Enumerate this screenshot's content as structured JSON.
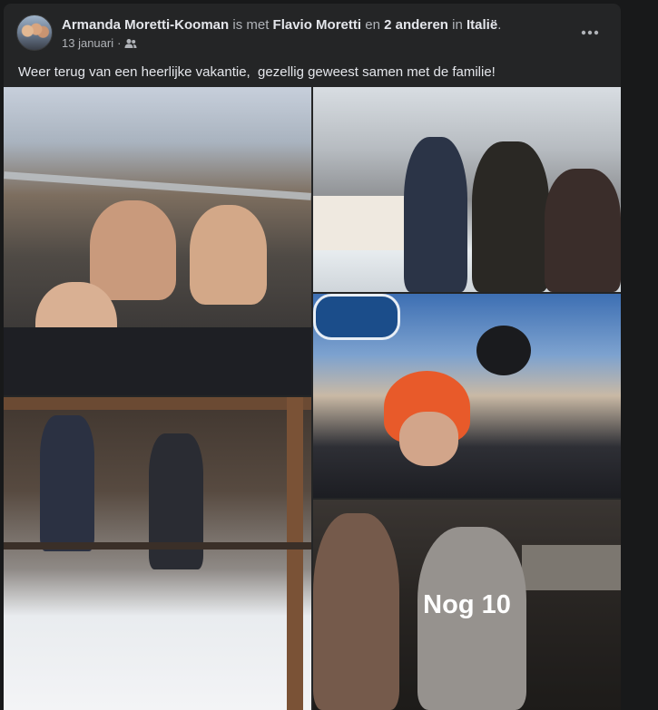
{
  "post": {
    "author": "Armanda Moretti-Kooman",
    "with_word": "is met",
    "tagged": "Flavio Moretti",
    "and_word": "en",
    "others": "2 anderen",
    "in_word": "in",
    "location": "Italië",
    "period": ".",
    "date": "13 januari",
    "separator": "·",
    "text": "Weer terug van een heerlijke vakantie,  gezellig geweest samen met de familie!"
  },
  "photos": {
    "more_count_label": "Nog 10"
  },
  "icons": {
    "audience": "friends-icon",
    "menu": "more-options-icon"
  },
  "colors": {
    "card_bg": "#242526",
    "page_bg": "#18191a",
    "primary_text": "#e4e6eb",
    "secondary_text": "#b0b3b8"
  }
}
